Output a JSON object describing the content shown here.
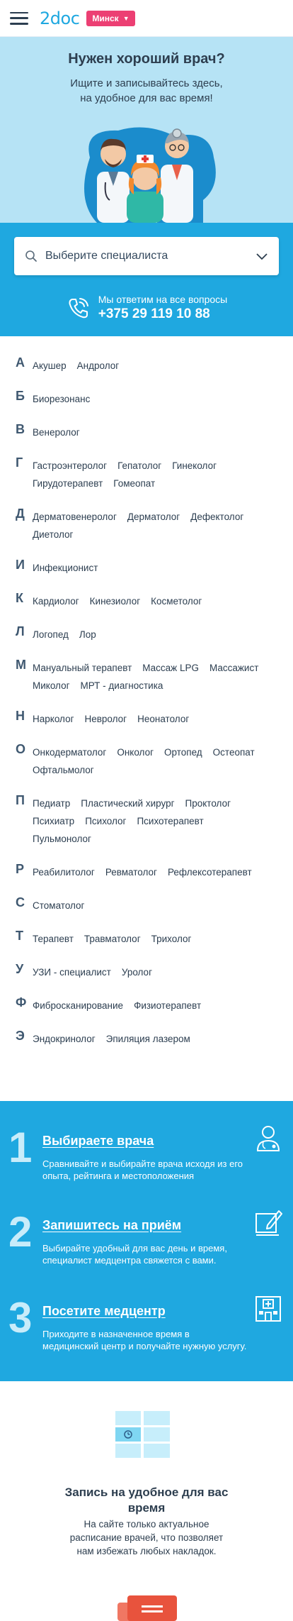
{
  "header": {
    "logo": "2doc",
    "city": "Минск"
  },
  "hero": {
    "title": "Нужен хороший врач?",
    "subtitle_line1": "Ищите и записывайтесь здесь,",
    "subtitle_line2": "на удобное для вас время!"
  },
  "search": {
    "placeholder": "Выберите специалиста"
  },
  "phone": {
    "caption": "Мы ответим на все вопросы",
    "number": "+375 29 119 10 88"
  },
  "alphabet": [
    {
      "letter": "А",
      "items": [
        "Акушер",
        "Андролог"
      ]
    },
    {
      "letter": "Б",
      "items": [
        "Биорезонанс"
      ]
    },
    {
      "letter": "В",
      "items": [
        "Венеролог"
      ]
    },
    {
      "letter": "Г",
      "items": [
        "Гастроэнтеролог",
        "Гепатолог",
        "Гинеколог",
        "Гирудотерапевт",
        "Гомеопат"
      ]
    },
    {
      "letter": "Д",
      "items": [
        "Дерматовенеролог",
        "Дерматолог",
        "Дефектолог",
        "Диетолог"
      ]
    },
    {
      "letter": "И",
      "items": [
        "Инфекционист"
      ]
    },
    {
      "letter": "К",
      "items": [
        "Кардиолог",
        "Кинезиолог",
        "Косметолог"
      ]
    },
    {
      "letter": "Л",
      "items": [
        "Логопед",
        "Лор"
      ]
    },
    {
      "letter": "М",
      "items": [
        "Мануальный терапевт",
        "Массаж LPG",
        "Массажист",
        "Миколог",
        "МРТ - диагностика"
      ]
    },
    {
      "letter": "Н",
      "items": [
        "Нарколог",
        "Невролог",
        "Неонатолог"
      ]
    },
    {
      "letter": "О",
      "items": [
        "Онкодерматолог",
        "Онколог",
        "Ортопед",
        "Остеопат",
        "Офтальмолог"
      ]
    },
    {
      "letter": "П",
      "items": [
        "Педиатр",
        "Пластический хирург",
        "Проктолог",
        "Психиатр",
        "Психолог",
        "Психотерапевт",
        "Пульмонолог"
      ]
    },
    {
      "letter": "Р",
      "items": [
        "Реабилитолог",
        "Ревматолог",
        "Рефлексотерапевт"
      ]
    },
    {
      "letter": "С",
      "items": [
        "Стоматолог"
      ]
    },
    {
      "letter": "Т",
      "items": [
        "Терапевт",
        "Травматолог",
        "Трихолог"
      ]
    },
    {
      "letter": "У",
      "items": [
        "УЗИ - специалист",
        "Уролог"
      ]
    },
    {
      "letter": "Ф",
      "items": [
        "Фиброскан­ирование",
        "Физиотерапевт"
      ]
    },
    {
      "letter": "Э",
      "items": [
        "Эндокринолог",
        "Эпиляция лазером"
      ]
    }
  ],
  "steps": [
    {
      "num": "1",
      "title": "Выбираете врача",
      "text": "Сравнивайте и выбирайте врача исходя из его опыта, рейтинга и местоположения",
      "icon": "doctor-icon"
    },
    {
      "num": "2",
      "title": "Запишитесь на приём",
      "text": "Выбирайте удобный для вас день и время, специалист медцентра свяжется с вами.",
      "icon": "edit-icon"
    },
    {
      "num": "3",
      "title": "Посетите медцентр",
      "text": "Приходите в назначенное время в медицинский центр и получайте нужную услугу.",
      "icon": "hospital-icon"
    }
  ],
  "feature": {
    "title_line1": "Запись на удобное для вас",
    "title_line2": "время",
    "text_line1": "На сайте только актуальное",
    "text_line2": "расписание врачей, что позволяет",
    "text_line3": "нам избежать любых накладок."
  },
  "colors": {
    "brand_blue": "#1fa8e0",
    "hero_bg": "#b6e3f5",
    "city_pink": "#ec3f73"
  }
}
